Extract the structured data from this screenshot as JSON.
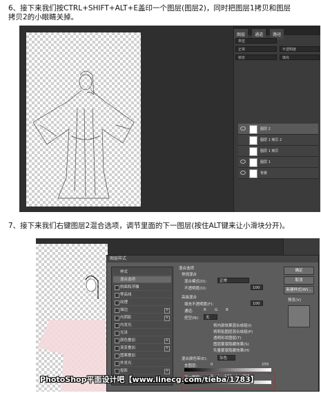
{
  "step6": {
    "line1": "6、接下来我们按CTRL+SHIFT+ALT+E盖印一个图层(图层2)，同时把图层1拷贝和图层",
    "line2": "拷贝2的小眼睛关掉。"
  },
  "step7": {
    "line1": "7、接下来我们右键图层2混合选项，调节里面的下一图层(按住ALT键来让小滑块分开)。"
  },
  "screenshot1": {
    "panel_tabs": [
      "图层",
      "通道",
      "路径"
    ],
    "kind_label": "类型",
    "blend_mode": "正常",
    "opacity_label": "不透明度",
    "fill_label": "填充",
    "lock_label": "锁定",
    "layers": [
      {
        "name": "图层 2",
        "visible": true,
        "selected": true
      },
      {
        "name": "图层 1 拷贝 2",
        "visible": false,
        "selected": false
      },
      {
        "name": "图层 1 拷贝",
        "visible": false,
        "selected": false
      },
      {
        "name": "图层 1",
        "visible": true,
        "selected": false
      },
      {
        "name": "背景",
        "visible": true,
        "selected": false
      }
    ]
  },
  "screenshot2": {
    "dialog_title": "图层样式",
    "style_list_header": "样式",
    "style_items": [
      "混合选项",
      "斜面和浮雕",
      "等高线",
      "纹理",
      "描边",
      "内阴影",
      "内发光",
      "光泽",
      "颜色叠加",
      "渐变叠加",
      "图案叠加",
      "外发光",
      "投影"
    ],
    "section_blend": "混合选项",
    "section_general": "常规混合",
    "blend_mode_label": "混合模式(D):",
    "blend_mode_value": "正常",
    "opacity_label": "不透明度(O):",
    "opacity_value": "100",
    "section_advanced": "高级混合",
    "fill_opacity_label": "填充不透明度(F):",
    "fill_opacity_value": "100",
    "channels_label": "通道:",
    "channels": [
      "R",
      "G",
      "B"
    ],
    "knockout_label": "挖空(N):",
    "knockout_value": "无",
    "options": [
      "将内部效果混合成组(I)",
      "将剪贴图层混合成组(P)",
      "透明形状图层(T)",
      "图层蒙版隐藏效果(S)",
      "矢量蒙版隐藏效果(H)"
    ],
    "blend_if_label": "混合颜色带(E):",
    "blend_if_value": "灰色",
    "this_layer_label": "本图层:",
    "this_layer_values": [
      "0",
      "255"
    ],
    "underlying_label": "下一图层:",
    "underlying_values": [
      "0",
      "/",
      "172",
      "/",
      "203"
    ],
    "buttons": [
      "确定",
      "取消",
      "新建样式(W)...",
      "预览(V)"
    ],
    "preview_checked": true
  },
  "watermark": "PhotoShop平面设计吧【www.linecg.com/tieba/1783】",
  "colors": {
    "ps_dark": "#2f2f2f",
    "panel": "#3b3b3b",
    "dialog": "#5c5c5c",
    "highlight_box": "#cc2222"
  }
}
